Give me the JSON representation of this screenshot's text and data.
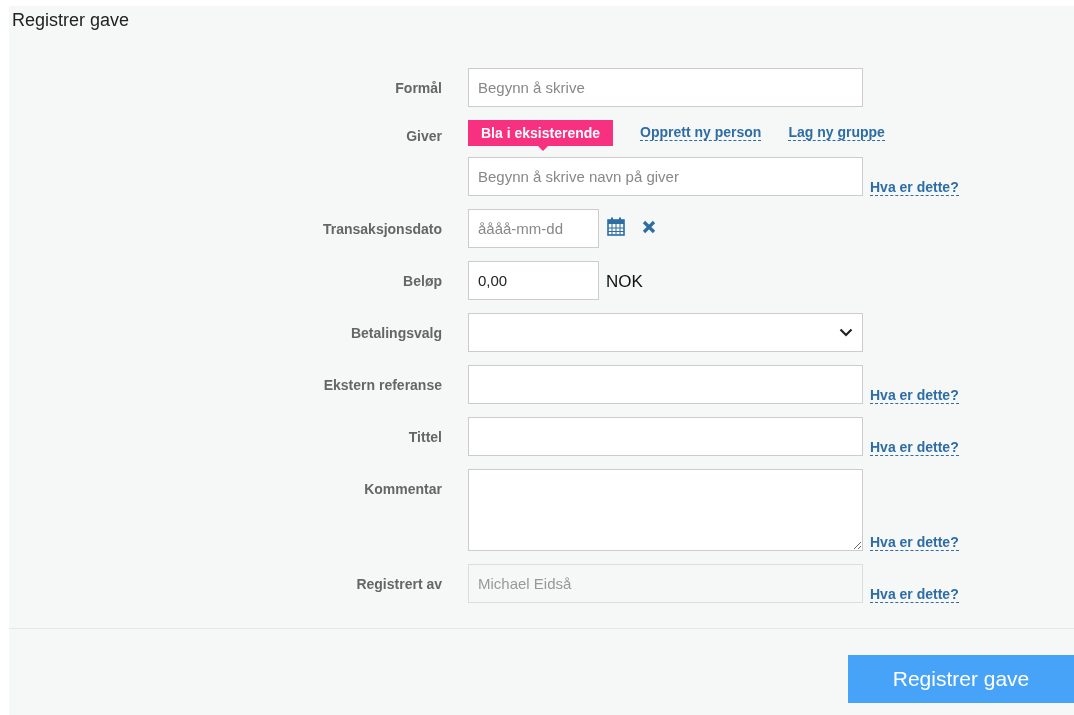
{
  "title": "Registrer gave",
  "fields": [
    {
      "kind": "text",
      "label": "Formål",
      "placeholder": "Begynn å skrive"
    },
    {
      "kind": "giver",
      "label": "Giver",
      "tabs": [
        {
          "label": "Bla i eksisterende",
          "selected": true
        },
        {
          "label": "Opprett ny person",
          "selected": false
        },
        {
          "label": "Lag ny gruppe",
          "selected": false
        }
      ],
      "placeholder": "Begynn å skrive navn på giver",
      "help": "Hva er dette?"
    },
    {
      "kind": "date",
      "label": "Transaksjonsdato",
      "placeholder": "åååå-mm-dd"
    },
    {
      "kind": "amount",
      "label": "Beløp",
      "value": "0,00",
      "currency": "NOK"
    },
    {
      "kind": "select",
      "label": "Betalingsvalg"
    },
    {
      "kind": "text",
      "label": "Ekstern referanse",
      "help": "Hva er dette?"
    },
    {
      "kind": "text",
      "label": "Tittel",
      "help": "Hva er dette?"
    },
    {
      "kind": "textarea",
      "label": "Kommentar",
      "help": "Hva er dette?"
    },
    {
      "kind": "readonly",
      "label": "Registrert av",
      "value": "Michael Eidså",
      "help": "Hva er dette?"
    }
  ],
  "submit": "Registrer gave"
}
